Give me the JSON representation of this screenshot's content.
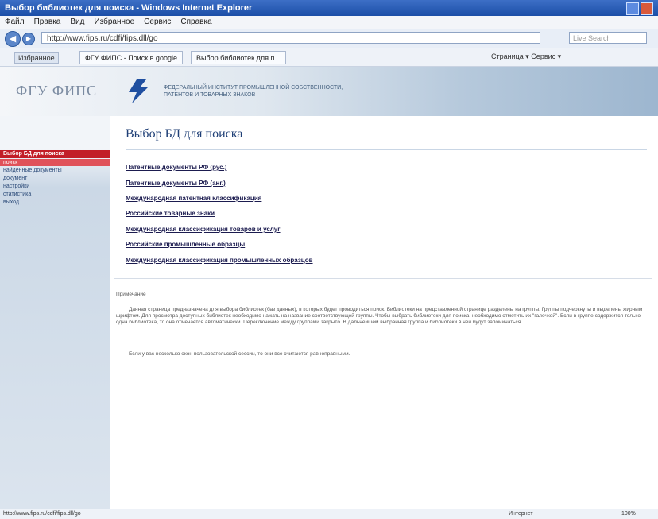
{
  "window": {
    "title": "Выбор библиотек для поиска - Windows Internet Explorer"
  },
  "menu": [
    "Файл",
    "Правка",
    "Вид",
    "Избранное",
    "Сервис",
    "Справка"
  ],
  "browser": {
    "address": "http://www.fips.ru/cdfi/fips.dll/go",
    "search_placeholder": "Live Search",
    "favorites_label": "Избранное",
    "tabs": [
      "ФГУ ФИПС - Поиск в google",
      "Выбор библиотек для п..."
    ],
    "tools_label": "Страница ▾  Сервис ▾"
  },
  "header": {
    "logo_text": "ФГУ ФИПС",
    "org_name": "ФЕДЕРАЛЬНЫЙ ИНСТИТУТ ПРОМЫШЛЕННОЙ СОБСТВЕННОСТИ, ПАТЕНТОВ И ТОВАРНЫХ ЗНАКОВ"
  },
  "sidebar": {
    "header": "Выбор БД для поиска",
    "items": [
      "поиск",
      "найденные документы",
      "документ",
      "настройки",
      "статистика",
      "выход"
    ]
  },
  "main": {
    "title": "Выбор БД для поиска",
    "databases": [
      "Патентные документы РФ (рус.)",
      "Патентные документы РФ (анг.)",
      "Международная патентная классификация",
      "Российские товарные знаки",
      "Международная классификация товаров и услуг",
      "Российские промышленные образцы",
      "Международная классификация промышленных образцов"
    ],
    "note_label": "Примечание",
    "note_text": "Данная страница предназначена для выбора библиотек (баз данных), в которых будет проводиться поиск. Библиотеки на представленной странице разделены на группы. Группы подчеркнуты и выделены жирным шрифтом. Для просмотра доступных библиотек необходимо нажать на название соответствующей группы. Чтобы выбрать библиотеки для поиска, необходимо отметить их \"галочкой\". Если в группе содержится только одна библиотека, то она отмечается автоматически. Переключение между группами закрыто. В дальнейшем выбранная группа и библиотеки в ней будут запоминаться.",
    "note_text2": "Если у вас несколько окон пользовательской сессии, то они все считаются равноправными."
  },
  "status": {
    "url": "http://www.fips.ru/cdfi/fips.dll/go",
    "zone": "Интернет",
    "zoom": "100%"
  }
}
